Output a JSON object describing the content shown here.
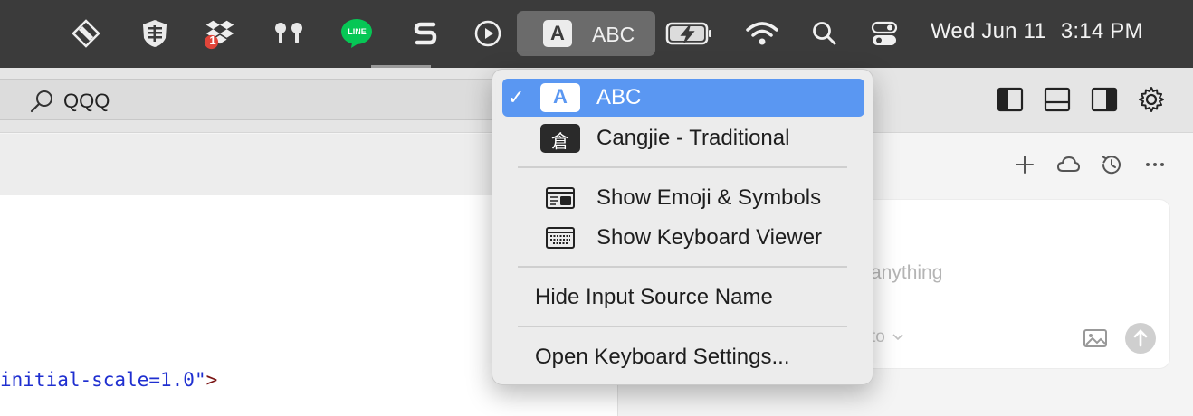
{
  "menubar": {
    "icons": [
      {
        "name": "layered-shapes-app-icon"
      },
      {
        "name": "shield-grid-app-icon"
      },
      {
        "name": "dropbox-icon",
        "badge": "1"
      },
      {
        "name": "airpods-icon"
      },
      {
        "name": "line-app-icon",
        "text": "LINE"
      },
      {
        "name": "s-app-icon"
      },
      {
        "name": "play-circle-icon"
      }
    ],
    "input_source": {
      "letter": "A",
      "label": "ABC"
    },
    "clock": {
      "date": "Wed Jun 11",
      "time": "3:14 PM"
    }
  },
  "toolbar": {
    "search_text": "QQQ"
  },
  "editor": {
    "code": {
      "text": "initial-scale=1.0",
      "quote": "\"",
      "close": ">"
    }
  },
  "chat": {
    "placeholder": "anything",
    "model_hint": "to"
  },
  "input_menu": {
    "sources": [
      {
        "label": "ABC",
        "letter": "A",
        "selected": true,
        "check": "✓"
      },
      {
        "label": "Cangjie - Traditional",
        "letter": "倉",
        "selected": false
      }
    ],
    "actions": [
      {
        "label": "Show Emoji & Symbols"
      },
      {
        "label": "Show Keyboard Viewer"
      }
    ],
    "hide_label": "Hide Input Source Name",
    "settings_label": "Open Keyboard Settings..."
  },
  "colors": {
    "menubar_bg": "#3b3b3b",
    "selection": "#5a97f2",
    "line_green": "#06c755",
    "badge_red": "#e0453a"
  }
}
